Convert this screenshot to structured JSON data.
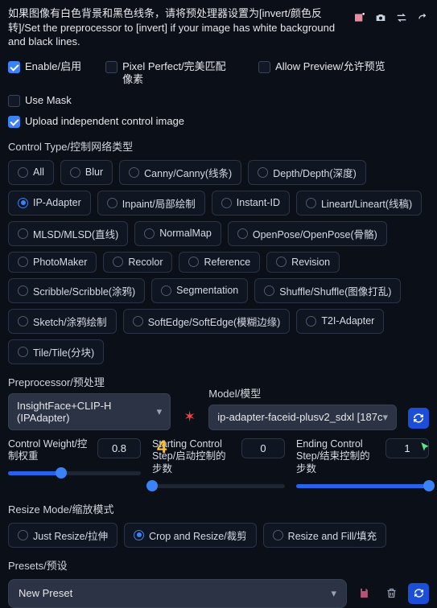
{
  "info_text": "如果图像有白色背景和黑色线条，请将预处理器设置为[invert/颜色反转]/Set the preprocessor to [invert] if your image has white background and black lines.",
  "checks": {
    "enable": {
      "label": "Enable/启用",
      "checked": true
    },
    "pixel_perfect": {
      "label": "Pixel Perfect/完美匹配像素",
      "checked": false
    },
    "allow_preview": {
      "label": "Allow Preview/允许预览",
      "checked": false
    },
    "use_mask": {
      "label": "Use Mask",
      "checked": false
    },
    "upload_independent": {
      "label": "Upload independent control image",
      "checked": true
    }
  },
  "control_type_label": "Control Type/控制网络类型",
  "control_types": [
    "All",
    "Blur",
    "Canny/Canny(线条)",
    "Depth/Depth(深度)",
    "IP-Adapter",
    "Inpaint/局部绘制",
    "Instant-ID",
    "Lineart/Lineart(线稿)",
    "MLSD/MLSD(直线)",
    "NormalMap",
    "OpenPose/OpenPose(骨骼)",
    "PhotoMaker",
    "Recolor",
    "Reference",
    "Revision",
    "Scribble/Scribble(涂鸦)",
    "Segmentation",
    "Shuffle/Shuffle(图像打乱)",
    "Sketch/涂鸦绘制",
    "SoftEdge/SoftEdge(模糊边缘)",
    "T2I-Adapter",
    "Tile/Tile(分块)"
  ],
  "control_type_selected": "IP-Adapter",
  "preprocessor": {
    "label": "Preprocessor/预处理",
    "value": "InsightFace+CLIP-H (IPAdapter)"
  },
  "model": {
    "label": "Model/模型",
    "value": "ip-adapter-faceid-plusv2_sdxl [187c"
  },
  "sliders": {
    "weight": {
      "label": "Control Weight/控制权重",
      "value": "0.8",
      "fill_pct": 40
    },
    "start": {
      "label": "Starting Control Step/启动控制的步数",
      "value": "0",
      "fill_pct": 0
    },
    "end": {
      "label": "Ending Control Step/结束控制的步数",
      "value": "1",
      "fill_pct": 100
    }
  },
  "resize_mode_label": "Resize Mode/缩放模式",
  "resize_modes": [
    "Just Resize/拉伸",
    "Crop and Resize/裁剪",
    "Resize and Fill/填充"
  ],
  "resize_mode_selected": "Crop and Resize/裁剪",
  "presets_label": "Presets/预设",
  "preset_value": "New Preset",
  "annotation": "4"
}
